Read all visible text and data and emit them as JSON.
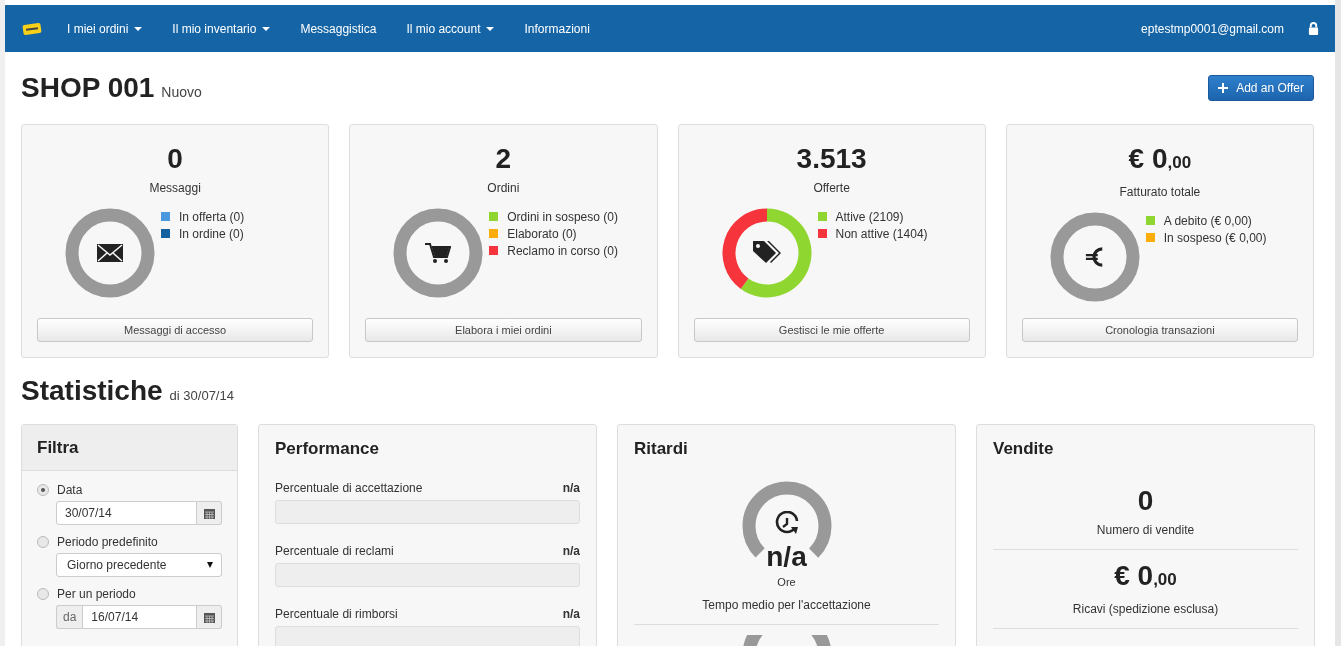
{
  "nav": {
    "items": [
      {
        "label": "I miei ordini",
        "dropdown": true
      },
      {
        "label": "Il mio inventario",
        "dropdown": true
      },
      {
        "label": "Messaggistica",
        "dropdown": false
      },
      {
        "label": "Il mio account",
        "dropdown": true
      },
      {
        "label": "Informazioni",
        "dropdown": false
      }
    ],
    "email": "eptestmp0001@gmail.com"
  },
  "header": {
    "title": "SHOP 001",
    "subtitle": "Nuovo",
    "add_button": "Add an Offer"
  },
  "summary_cards": [
    {
      "value": "0",
      "label": "Messaggi",
      "legend": [
        {
          "label": "In offerta (0)",
          "color": "#4a98de"
        },
        {
          "label": "In ordine (0)",
          "color": "#13609f"
        }
      ],
      "button": "Messaggi di accesso"
    },
    {
      "value": "2",
      "label": "Ordini",
      "legend": [
        {
          "label": "Ordini in sospeso (0)",
          "color": "#8fd630"
        },
        {
          "label": "Elaborato (0)",
          "color": "#fbad0c"
        },
        {
          "label": "Reclamo in corso (0)",
          "color": "#f5343b"
        }
      ],
      "button": "Elabora i miei ordini"
    },
    {
      "value": "3.513",
      "label": "Offerte",
      "button": "Gestisci le mie offerte",
      "chart_data": {
        "type": "donut",
        "categories": [
          "Attive (2109)",
          "Non attive (1404)"
        ],
        "values": [
          2109,
          1404
        ],
        "colors": [
          "#8fd630",
          "#f5343b"
        ]
      }
    },
    {
      "value": "€ 0",
      "decimals": ",00",
      "label": "Fatturato totale",
      "legend": [
        {
          "label": "A debito (€ 0,00)",
          "color": "#8fd630"
        },
        {
          "label": "In sospeso (€ 0,00)",
          "color": "#fbad0c"
        }
      ],
      "button": "Cronologia transazioni"
    }
  ],
  "stats": {
    "title": "Statistiche",
    "date": "di 30/07/14"
  },
  "filter": {
    "title": "Filtra",
    "options": [
      {
        "kind": "date",
        "label": "Data",
        "selected": true,
        "value": "30/07/14"
      },
      {
        "kind": "select",
        "label": "Periodo predefinito",
        "selected": false,
        "value": "Giorno precedente"
      },
      {
        "kind": "range",
        "label": "Per un periodo",
        "selected": false,
        "prefix": "da",
        "value": "16/07/14"
      }
    ]
  },
  "performance": {
    "title": "Performance",
    "metrics": [
      {
        "label": "Percentuale di accettazione",
        "reading": "n/a"
      },
      {
        "label": "Percentuale di reclami",
        "reading": "n/a"
      },
      {
        "label": "Percentuale di rimborsi",
        "reading": "n/a"
      }
    ]
  },
  "delays": {
    "title": "Ritardi",
    "gauges": [
      {
        "value": "n/a",
        "unit": "Ore",
        "label": "Tempo medio per l'accettazione"
      }
    ]
  },
  "sales": {
    "title": "Vendite",
    "stats": [
      {
        "value": "0",
        "label": "Numero di vendite"
      },
      {
        "value": "€ 0",
        "decimals": ",00",
        "label": "Ricavi (spedizione esclusa)"
      }
    ]
  }
}
